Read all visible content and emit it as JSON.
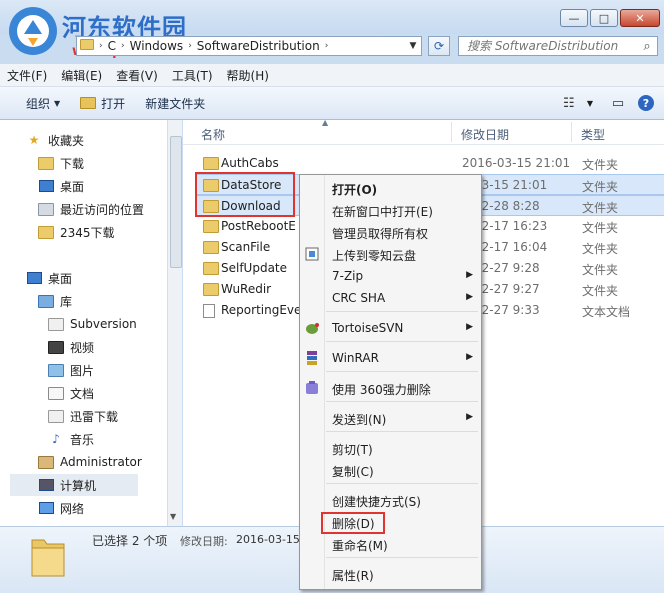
{
  "window": {
    "watermark_text": "河东软件园",
    "watermark_url": "www.pc0359.cn",
    "min_glyph": "—",
    "max_glyph": "□",
    "close_glyph": "✕"
  },
  "address": {
    "crumbs": [
      "C",
      "Windows",
      "SoftwareDistribution"
    ],
    "search_placeholder": "搜索 SoftwareDistribution"
  },
  "menu": [
    "文件(F)",
    "编辑(E)",
    "查看(V)",
    "工具(T)",
    "帮助(H)"
  ],
  "toolbar": {
    "organize": "组织",
    "open": "打开",
    "new_folder": "新建文件夹"
  },
  "nav": {
    "favorites": "收藏夹",
    "downloads": "下载",
    "desktop": "桌面",
    "recent": "最近访问的位置",
    "downloads_2345": "2345下载",
    "desktop_root": "桌面",
    "library": "库",
    "subversion": "Subversion",
    "video": "视频",
    "pictures": "图片",
    "documents": "文档",
    "thunder": "迅雷下载",
    "music": "音乐",
    "admin": "Administrator",
    "computer": "计算机",
    "network": "网络"
  },
  "columns": {
    "name": "名称",
    "date": "修改日期",
    "type": "类型"
  },
  "files": [
    {
      "name": "AuthCabs",
      "date": "2016-03-15 21:01",
      "type": "文件夹"
    },
    {
      "name": "DataStore",
      "date": "5-03-15 21:01",
      "type": "文件夹"
    },
    {
      "name": "Download",
      "date": "7-02-28 8:28",
      "type": "文件夹"
    },
    {
      "name": "PostRebootE",
      "date": "7-02-17 16:23",
      "type": "文件夹"
    },
    {
      "name": "ScanFile",
      "date": "7-02-17 16:04",
      "type": "文件夹"
    },
    {
      "name": "SelfUpdate",
      "date": "7-02-27 9:28",
      "type": "文件夹"
    },
    {
      "name": "WuRedir",
      "date": "7-02-27 9:27",
      "type": "文件夹"
    },
    {
      "name": "ReportingEve",
      "date": "7-02-27 9:33",
      "type": "文本文档"
    }
  ],
  "details": {
    "selected": "已选择 2 个项",
    "date_label": "修改日期:",
    "date_value": "2016-03-15"
  },
  "context_menu": {
    "open": "打开(O)",
    "open_new_window": "在新窗口中打开(E)",
    "take_ownership": "管理员取得所有权",
    "upload_cloud": "上传到零知云盘",
    "zip": "7-Zip",
    "crc": "CRC SHA",
    "tortoise": "TortoiseSVN",
    "winrar": "WinRAR",
    "force_delete": "使用 360强力删除",
    "send_to": "发送到(N)",
    "cut": "剪切(T)",
    "copy": "复制(C)",
    "shortcut": "创建快捷方式(S)",
    "delete": "删除(D)",
    "rename": "重命名(M)",
    "properties": "属性(R)"
  },
  "colors": {
    "highlight_red": "#e0342f",
    "selection": "#d8e8fa"
  }
}
